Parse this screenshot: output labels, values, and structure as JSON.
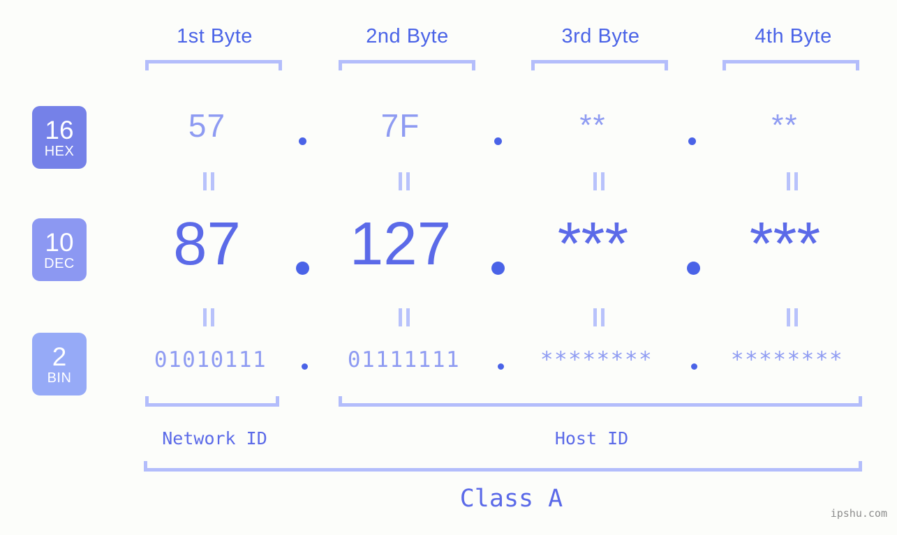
{
  "background": "#fcfdfa",
  "colors": {
    "header_text": "#4a63e7",
    "bracket": "#b3bdfb",
    "hex_value": "#8e9bf2",
    "dec_value": "#5b6ae8",
    "bin_value": "#8e9bf2",
    "dot": "#4a63e7",
    "eqbar": "#b8c2fb",
    "badge_hex": "#7581e8",
    "badge_dec": "#8c98f2",
    "badge_bin": "#96aaf7",
    "watermark": "#8d8d8d"
  },
  "byte_headers": [
    {
      "label": "1st Byte"
    },
    {
      "label": "2nd Byte"
    },
    {
      "label": "3rd Byte"
    },
    {
      "label": "4th Byte"
    }
  ],
  "radix_badges": [
    {
      "number": "16",
      "word": "HEX"
    },
    {
      "number": "10",
      "word": "DEC"
    },
    {
      "number": "2",
      "word": "BIN"
    }
  ],
  "rows": {
    "hex": {
      "values": [
        "57",
        "7F",
        "**",
        "**"
      ],
      "separator": "."
    },
    "dec": {
      "values": [
        "87",
        "127",
        "***",
        "***"
      ],
      "separator": "."
    },
    "bin": {
      "values": [
        "01010111",
        "01111111",
        "********",
        "********"
      ],
      "separator": "."
    }
  },
  "equality_symbol": "||",
  "segments": [
    {
      "label": "Network ID"
    },
    {
      "label": "Host ID"
    }
  ],
  "ip_class": {
    "label": "Class A"
  },
  "watermark": {
    "text": "ipshu.com"
  }
}
